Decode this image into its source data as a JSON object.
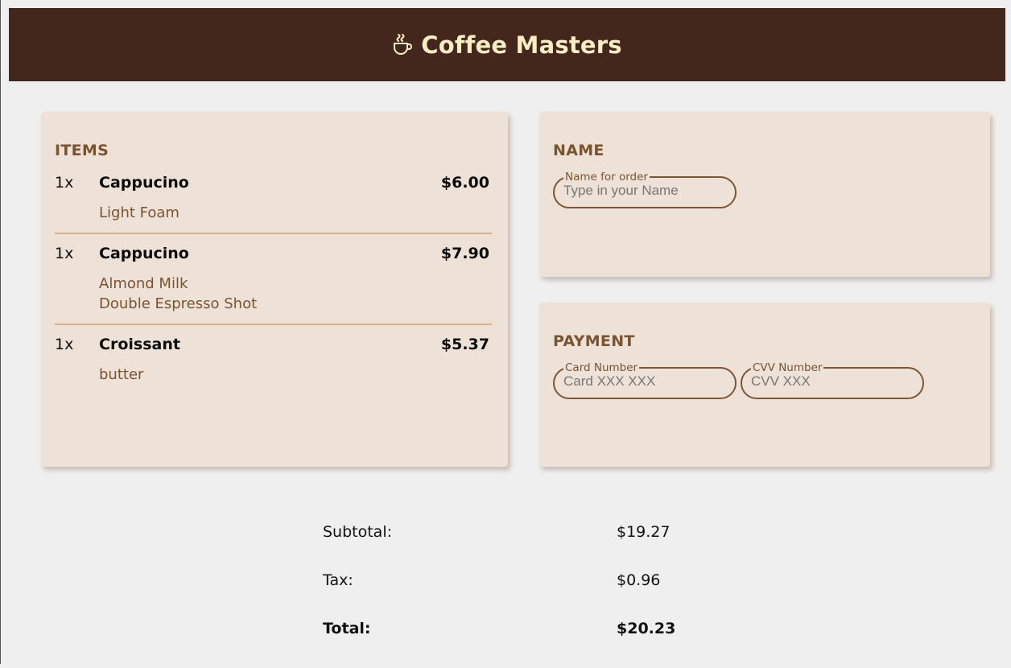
{
  "header": {
    "title": "Coffee Masters",
    "icon": "coffee-cup-icon",
    "background": "#43271c",
    "title_color": "#fbeec4"
  },
  "items_card": {
    "title": "ITEMS",
    "items": [
      {
        "qty": "1x",
        "name": "Cappucino",
        "price": "$6.00",
        "options": [
          "Light Foam"
        ]
      },
      {
        "qty": "1x",
        "name": "Cappucino",
        "price": "$7.90",
        "options": [
          "Almond Milk",
          "Double Espresso Shot"
        ]
      },
      {
        "qty": "1x",
        "name": "Croissant",
        "price": "$5.37",
        "options": [
          "butter"
        ]
      }
    ]
  },
  "name_card": {
    "title": "NAME",
    "name_field": {
      "legend": "Name for order",
      "placeholder": "Type in your Name",
      "value": ""
    }
  },
  "payment_card": {
    "title": "PAYMENT",
    "card_field": {
      "legend": "Card Number",
      "placeholder": "Card XXX XXX",
      "value": ""
    },
    "cvv_field": {
      "legend": "CVV Number",
      "placeholder": "CVV XXX",
      "value": ""
    }
  },
  "totals": {
    "subtotal_label": "Subtotal:",
    "subtotal_value": "$19.27",
    "tax_label": "Tax:",
    "tax_value": "$0.96",
    "total_label": "Total:",
    "total_value": "$20.23"
  },
  "colors": {
    "accent_brown": "#7a5431",
    "card_bg": "#ede1d8",
    "divider": "#d9b08a"
  }
}
